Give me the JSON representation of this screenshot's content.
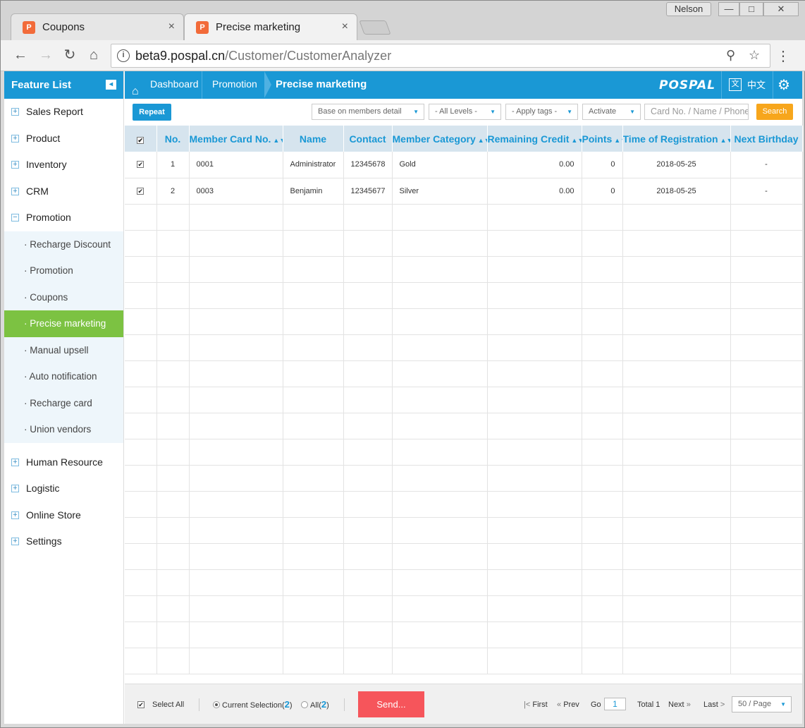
{
  "browser": {
    "user": "Nelson",
    "window_controls": {
      "minimize": "—",
      "maximize": "□",
      "close": "✕"
    },
    "tabs": [
      {
        "title": "Coupons",
        "close": "×"
      },
      {
        "title": "Precise marketing",
        "close": "×"
      }
    ],
    "url_host": "beta9.pospal.cn",
    "url_path": "/Customer/CustomerAnalyzer",
    "icons": [
      "back-arrow-icon",
      "forward-arrow-icon",
      "reload-icon",
      "home-icon",
      "info-icon",
      "zoom-icon",
      "star-icon",
      "menu-dots-icon"
    ]
  },
  "sidebar": {
    "title": "Feature List",
    "items_top": [
      {
        "label": "Sales Report",
        "toggle": "+"
      },
      {
        "label": "Product",
        "toggle": "+"
      },
      {
        "label": "Inventory",
        "toggle": "+"
      },
      {
        "label": "CRM",
        "toggle": "+"
      },
      {
        "label": "Promotion",
        "toggle": "−"
      }
    ],
    "promotion_sub": [
      {
        "label": "· Recharge Discount"
      },
      {
        "label": "· Promotion"
      },
      {
        "label": "· Coupons"
      },
      {
        "label": "· Precise marketing"
      },
      {
        "label": "· Manual upsell"
      },
      {
        "label": "· Auto notification"
      },
      {
        "label": "· Recharge card"
      },
      {
        "label": "· Union vendors"
      }
    ],
    "active_item": "· Precise marketing",
    "items_bottom": [
      {
        "label": "Human Resource",
        "toggle": "+"
      },
      {
        "label": "Logistic",
        "toggle": "+"
      },
      {
        "label": "Online Store",
        "toggle": "+"
      },
      {
        "label": "Settings",
        "toggle": "+"
      }
    ]
  },
  "topbar": {
    "dashboard": "Dashboard",
    "promotion": "Promotion",
    "current": "Precise marketing",
    "logo": "POSPAL",
    "lang": "中文",
    "lang_icon": "文",
    "colors": {
      "primary": "#1a98d5",
      "accent_green": "#7cc242",
      "search_orange": "#f7a61c",
      "send_red": "#f6555b"
    }
  },
  "filters": {
    "repeat": "Repeat",
    "basis": "Base on members detail",
    "levels": "- All Levels -",
    "tags": "- Apply tags -",
    "status": "Activate",
    "search_placeholder": "Card No. / Name / Phone",
    "search_button": "Search"
  },
  "table": {
    "headers": {
      "no": "No.",
      "card": "Member Card No.",
      "name": "Name",
      "contact": "Contact",
      "category": "Member Category",
      "credit": "Remaining Credit",
      "points": "Points",
      "registration": "Time of Registration",
      "birthday": "Next Birthday"
    },
    "rows": [
      {
        "no": "1",
        "card": "0001",
        "name": "Administrator",
        "contact": "12345678",
        "category": "Gold",
        "credit": "0.00",
        "points": "0",
        "registration": "2018-05-25",
        "birthday": "-"
      },
      {
        "no": "2",
        "card": "0003",
        "name": "Benjamin",
        "contact": "12345677",
        "category": "Silver",
        "credit": "0.00",
        "points": "0",
        "registration": "2018-05-25",
        "birthday": "-"
      }
    ],
    "empty_rows": 18
  },
  "footer": {
    "select_all": "Select All",
    "current_selection": "Current Selection",
    "current_count": "2",
    "all": "All",
    "all_count": "2",
    "send": "Send...",
    "first": "First",
    "prev": "Prev",
    "go": "Go",
    "page": "1",
    "total": "Total 1",
    "next": "Next",
    "last": "Last",
    "per_page": "50 / Page"
  }
}
